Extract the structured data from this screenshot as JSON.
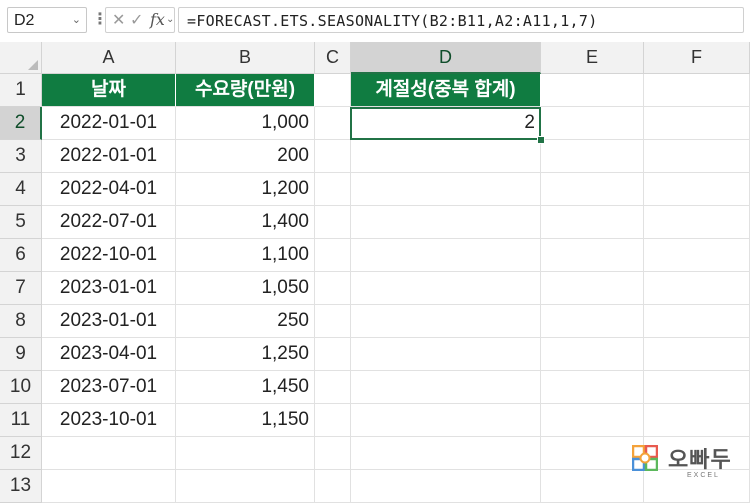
{
  "formula_bar": {
    "name_box": "D2",
    "formula": "=FORECAST.ETS.SEASONALITY(B2:B11,A2:A11,1,7)",
    "fx_icon": "fx"
  },
  "columns": [
    "A",
    "B",
    "C",
    "D",
    "E",
    "F"
  ],
  "rows": [
    "1",
    "2",
    "3",
    "4",
    "5",
    "6",
    "7",
    "8",
    "9",
    "10",
    "11",
    "12",
    "13"
  ],
  "selected_cell": "D2",
  "header": {
    "date": "날짜",
    "demand": "수요량(만원)",
    "seasonality": "계절성(중복 합계)"
  },
  "table": [
    {
      "date": "2022-01-01",
      "demand": "1,000"
    },
    {
      "date": "2022-01-01",
      "demand": "200"
    },
    {
      "date": "2022-04-01",
      "demand": "1,200"
    },
    {
      "date": "2022-07-01",
      "demand": "1,400"
    },
    {
      "date": "2022-10-01",
      "demand": "1,100"
    },
    {
      "date": "2023-01-01",
      "demand": "1,050"
    },
    {
      "date": "2023-01-01",
      "demand": "250"
    },
    {
      "date": "2023-04-01",
      "demand": "1,250"
    },
    {
      "date": "2023-07-01",
      "demand": "1,450"
    },
    {
      "date": "2023-10-01",
      "demand": "1,150"
    }
  ],
  "result": "2",
  "colors": {
    "header_fill": "#107c41",
    "selection": "#217346"
  },
  "logo": {
    "text": "오빠두",
    "sub": "EXCEL"
  }
}
